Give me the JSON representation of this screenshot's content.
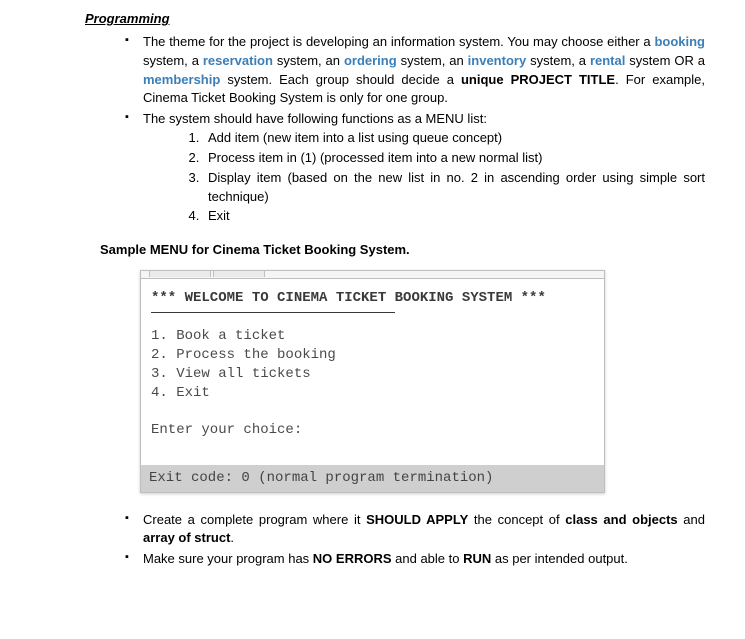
{
  "heading": "Programming",
  "p1": {
    "t1": "The theme for the project is developing an information system. You may choose either a ",
    "h1": "booking",
    "t2": " system, a ",
    "h2": "reservation",
    "t3": " system, an ",
    "h3": "ordering",
    "t4": " system, an ",
    "h4": "inventory",
    "t5": " system, a ",
    "h5": "rental",
    "t6": " system OR a ",
    "h6": "membership",
    "t7": " system. Each group should decide a ",
    "b1": "unique PROJECT TITLE",
    "t8": ". For example, Cinema Ticket Booking System is only for one group."
  },
  "p2_intro": "The system should have following functions as a MENU list:",
  "p2_items": [
    "Add item (new item into a list using queue concept)",
    "Process item in (1) (processed item into a new normal list)",
    "Display item (based on the new list in no. 2 in ascending order using simple sort technique)",
    "Exit"
  ],
  "sample_heading": "Sample MENU for Cinema Ticket Booking System.",
  "console": {
    "title": "*** WELCOME TO CINEMA TICKET BOOKING SYSTEM ***",
    "lines": [
      "1. Book a ticket",
      "2. Process the booking",
      "3. View all tickets",
      "4. Exit"
    ],
    "prompt": "Enter your choice:",
    "status": "Exit code: 0 (normal program termination)"
  },
  "p3": {
    "t1": "Create a complete program where it ",
    "b1": "SHOULD APPLY",
    "t2": " the concept of ",
    "b2": "class and objects",
    "t3": " and ",
    "b3": "array of struct",
    "t4": "."
  },
  "p4": {
    "t1": "Make sure your program has ",
    "b1": "NO ERRORS",
    "t2": " and able to ",
    "b2": "RUN",
    "t3": " as per intended output."
  }
}
